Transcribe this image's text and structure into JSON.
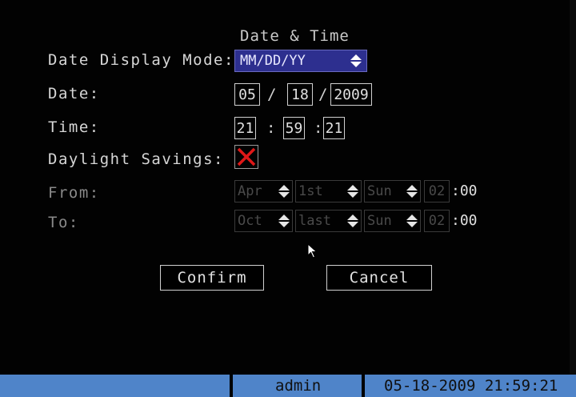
{
  "title": "Date & Time",
  "labels": {
    "date_display_mode": "Date Display Mode:",
    "date": "Date:",
    "time": "Time:",
    "daylight_savings": "Daylight Savings:",
    "from": "From:",
    "to": "To:"
  },
  "date_display_mode": {
    "value": "MM/DD/YY"
  },
  "date": {
    "month": "05",
    "day": "18",
    "year": "2009",
    "separator": "/"
  },
  "time": {
    "hour": "21",
    "minute": "59",
    "second": "21",
    "separator": ":"
  },
  "daylight_savings": {
    "checked": false
  },
  "dst_from": {
    "month": "Apr",
    "week": "1st",
    "day": "Sun",
    "hour": "02",
    "minutes": ":00"
  },
  "dst_to": {
    "month": "Oct",
    "week": "last",
    "day": "Sun",
    "hour": "02",
    "minutes": ":00"
  },
  "buttons": {
    "confirm": "Confirm",
    "cancel": "Cancel"
  },
  "status_bar": {
    "user": "admin",
    "datetime": "05-18-2009 21:59:21"
  },
  "colors": {
    "background": "#000000",
    "select_highlight": "#2d2f8f",
    "status_bar": "#4f84c9",
    "checkbox_x": "#e01818"
  },
  "icons": {
    "updown": "updown-arrows-icon",
    "checkbox": "red-x-icon",
    "cursor": "mouse-pointer-icon"
  }
}
